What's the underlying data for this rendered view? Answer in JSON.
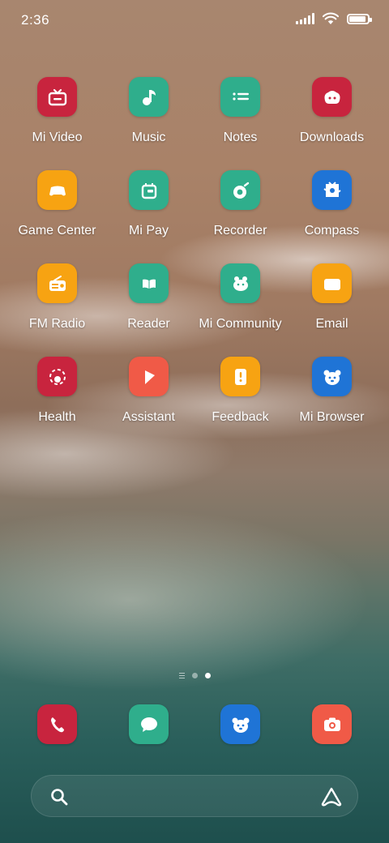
{
  "status_bar": {
    "time": "2:36",
    "battery_level": 0.9
  },
  "apps": [
    {
      "label": "Mi Video",
      "icon": "tv-icon",
      "color": "#c8243e"
    },
    {
      "label": "Music",
      "icon": "music-note-icon",
      "color": "#2fae8c"
    },
    {
      "label": "Notes",
      "icon": "list-icon",
      "color": "#2fae8c"
    },
    {
      "label": "Downloads",
      "icon": "download-cloud-icon",
      "color": "#c8243e"
    },
    {
      "label": "Game Center",
      "icon": "gamepad-icon",
      "color": "#f7a312"
    },
    {
      "label": "Mi Pay",
      "icon": "wallet-icon",
      "color": "#2fae8c"
    },
    {
      "label": "Recorder",
      "icon": "record-icon",
      "color": "#2fae8c"
    },
    {
      "label": "Compass",
      "icon": "compass-icon",
      "color": "#1f74d6"
    },
    {
      "label": "FM Radio",
      "icon": "radio-icon",
      "color": "#f7a312"
    },
    {
      "label": "Reader",
      "icon": "book-icon",
      "color": "#2fae8c"
    },
    {
      "label": "Mi Community",
      "icon": "community-icon",
      "color": "#2fae8c"
    },
    {
      "label": "Email",
      "icon": "envelope-icon",
      "color": "#f7a312"
    },
    {
      "label": "Health",
      "icon": "health-icon",
      "color": "#c8243e"
    },
    {
      "label": "Assistant",
      "icon": "assistant-icon",
      "color": "#f05a47"
    },
    {
      "label": "Feedback",
      "icon": "feedback-icon",
      "color": "#f7a312"
    },
    {
      "label": "Mi Browser",
      "icon": "browser-icon",
      "color": "#1f74d6"
    }
  ],
  "dock": [
    {
      "icon": "phone-icon",
      "color": "#c8243e"
    },
    {
      "icon": "message-icon",
      "color": "#2fae8c"
    },
    {
      "icon": "browser-icon",
      "color": "#1f74d6"
    },
    {
      "icon": "camera-icon",
      "color": "#f05a47"
    }
  ],
  "page_indicator": {
    "pages": 2,
    "active": 2
  }
}
